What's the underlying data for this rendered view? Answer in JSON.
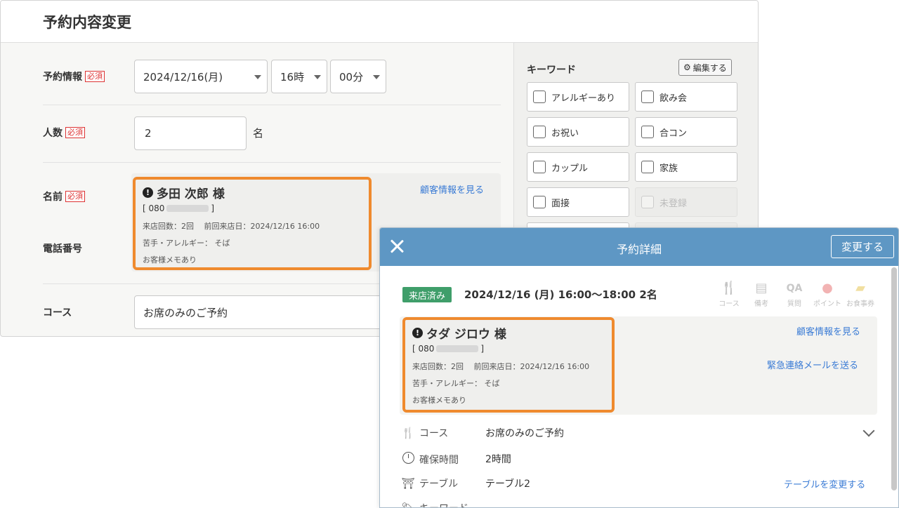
{
  "form": {
    "title": "予約内容変更",
    "required_badge": "必須",
    "reservation_info": {
      "label": "予約情報",
      "date": "2024/12/16(月)",
      "hour": "16時",
      "minute": "00分"
    },
    "party_size": {
      "label": "人数",
      "value": "2",
      "unit": "名"
    },
    "name": {
      "label": "名前"
    },
    "phone": {
      "label": "電話番号"
    },
    "course": {
      "label": "コース",
      "value": "お席のみのご予約"
    },
    "customer_card": {
      "name": "多田 次郎 様",
      "phone_prefix": "[ 080",
      "phone_suffix": "]",
      "visits": "来店回数：2回　 前回来店日：2024/12/16 16:00",
      "allergy": "苦手・アレルギー： そば",
      "memo": "お客様メモあり"
    },
    "view_customer_link": "顧客情報を見る"
  },
  "keywords": {
    "title": "キーワード",
    "edit_label": "編集する",
    "items": [
      {
        "label": "アレルギーあり",
        "disabled": false
      },
      {
        "label": "飲み会",
        "disabled": false
      },
      {
        "label": "お祝い",
        "disabled": false
      },
      {
        "label": "合コン",
        "disabled": false
      },
      {
        "label": "カップル",
        "disabled": false
      },
      {
        "label": "家族",
        "disabled": false
      },
      {
        "label": "面接",
        "disabled": false
      },
      {
        "label": "未登録",
        "disabled": true
      }
    ]
  },
  "detail_modal": {
    "title": "予約詳細",
    "change_button": "変更する",
    "status_badge": "来店済み",
    "summary": "2024/12/16 (月) 16:00〜18:00 2名",
    "toolbar_icons": [
      {
        "icon": "utensils-icon",
        "label": "コース"
      },
      {
        "icon": "memo-icon",
        "label": "備考"
      },
      {
        "icon": "qa-icon",
        "label": "質問"
      },
      {
        "icon": "point-icon",
        "label": "ポイント"
      },
      {
        "icon": "meal-ticket-icon",
        "label": "お食事券"
      }
    ],
    "customer_card": {
      "name": "タダ ジロウ 様",
      "phone_prefix": "[ 080",
      "phone_suffix": "]",
      "visits": "来店回数：2回　 前回来店日：2024/12/16 16:00",
      "allergy": "苦手・アレルギー： そば",
      "memo": "お客様メモあり"
    },
    "view_customer_link": "顧客情報を見る",
    "emergency_mail_link": "緊急連絡メールを送る",
    "course": {
      "label": "コース",
      "value": "お席のみのご予約"
    },
    "duration": {
      "label": "確保時間",
      "value": "2時間"
    },
    "table": {
      "label": "テーブル",
      "value": "テーブル2",
      "change_link": "テーブルを変更する"
    },
    "keyword_label": "キーワード"
  }
}
